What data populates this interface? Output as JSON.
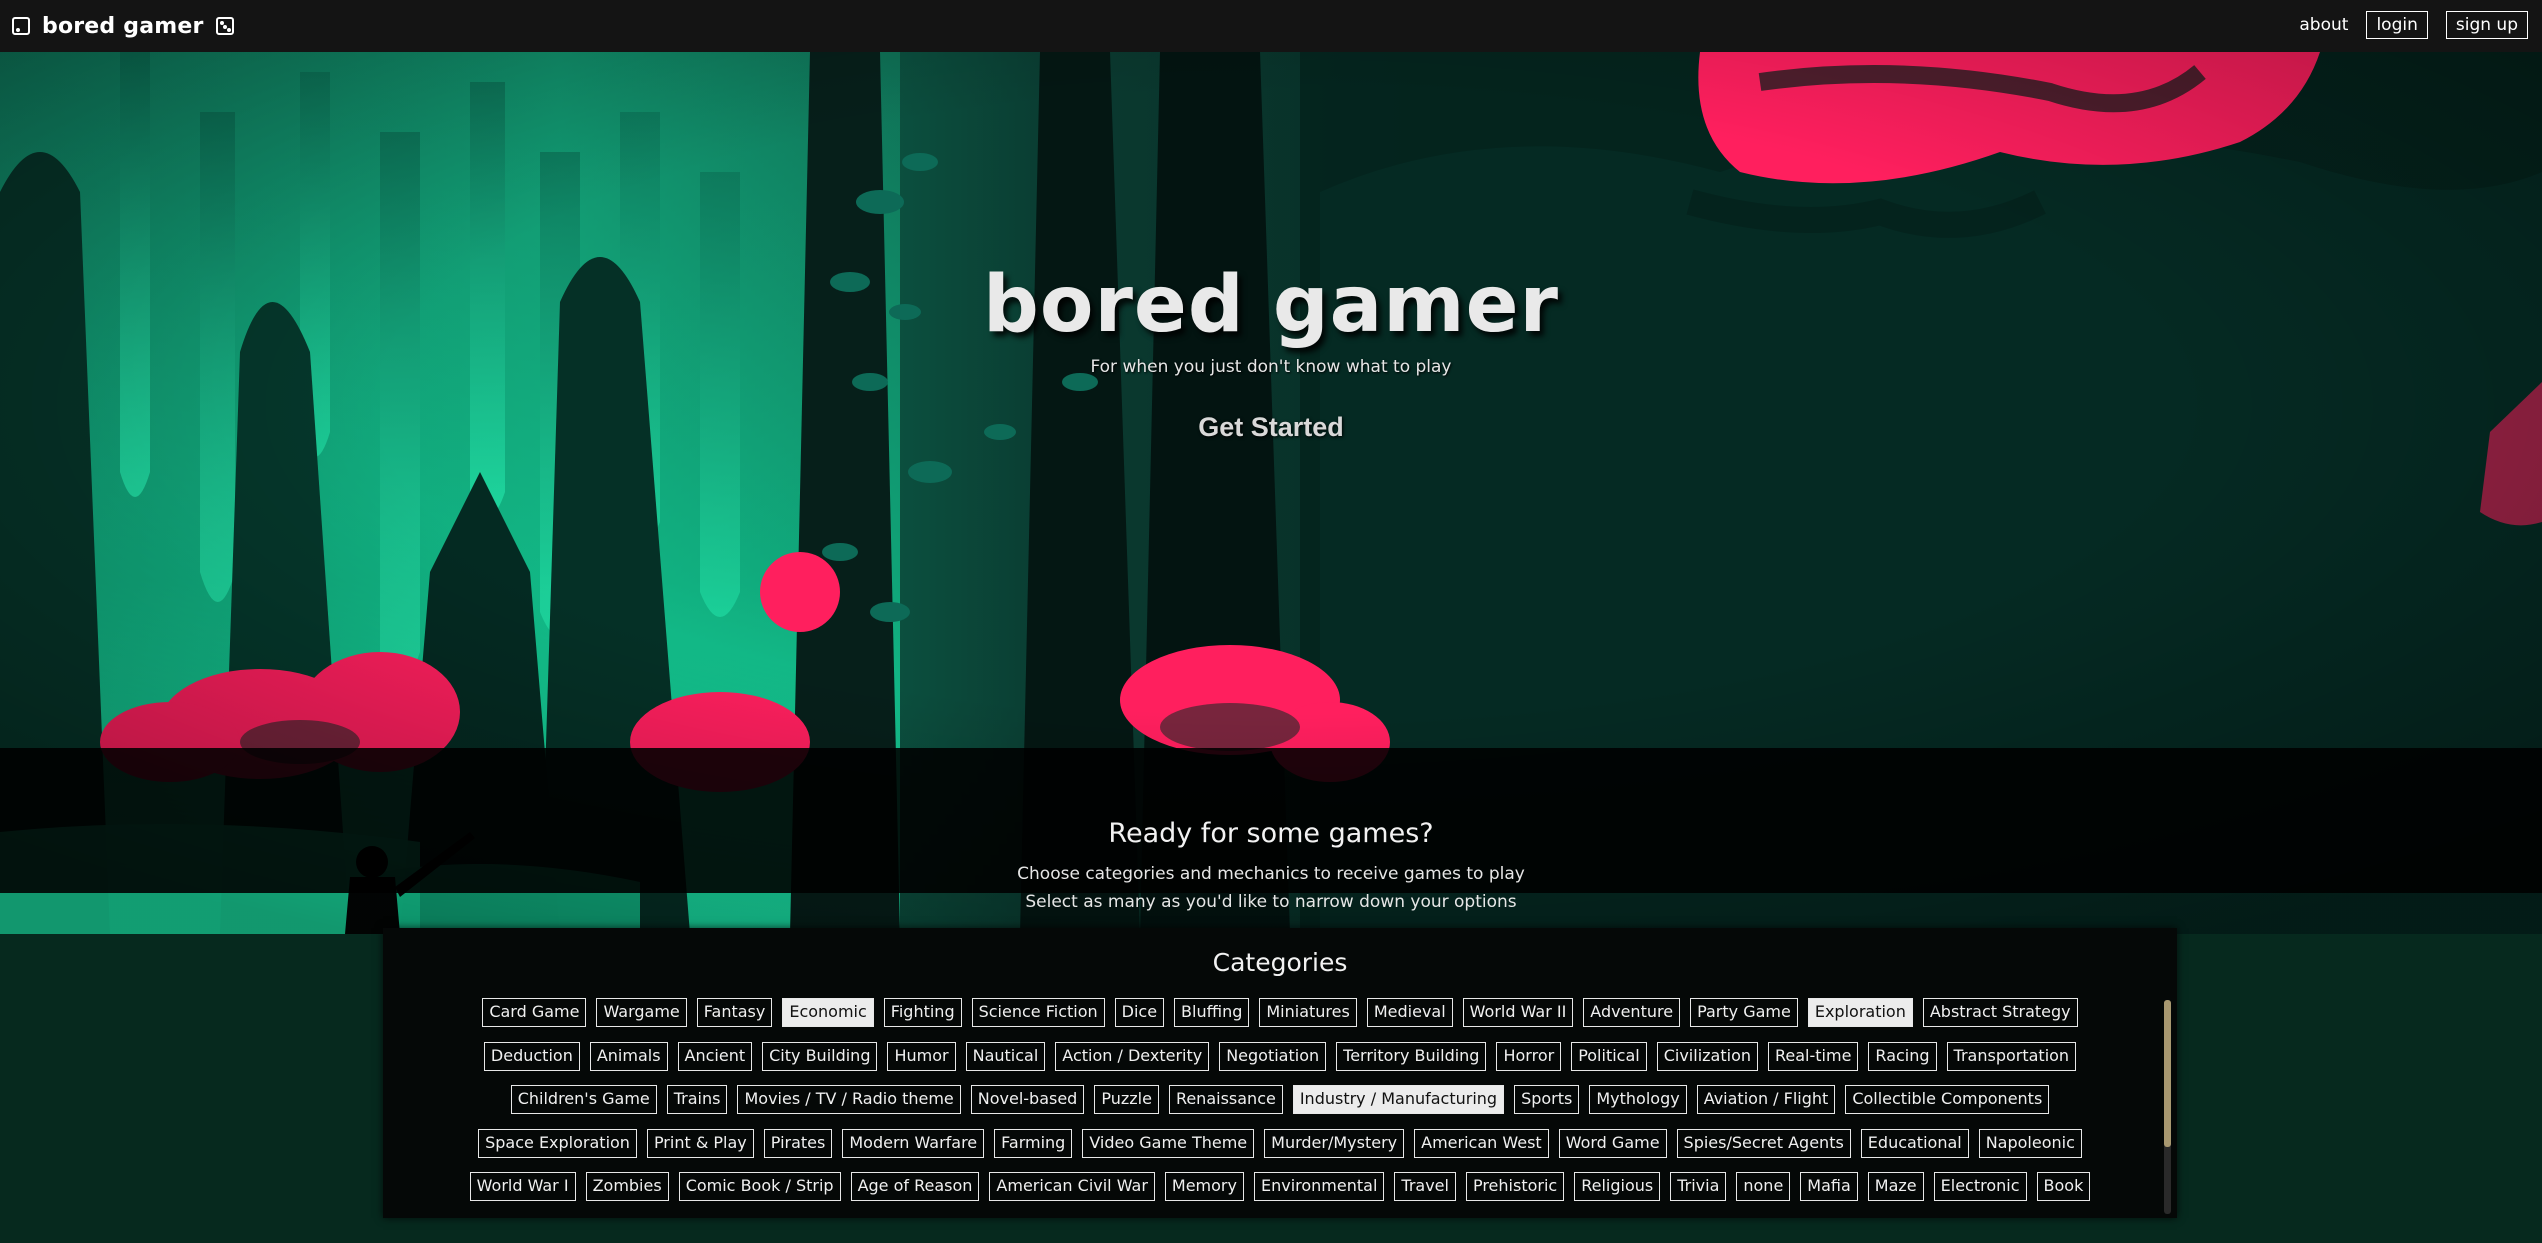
{
  "nav": {
    "brand": "bored gamer",
    "about": "about",
    "login": "login",
    "signup": "sign up"
  },
  "hero": {
    "title": "bored gamer",
    "subtitle": "For when you just don't know what to play",
    "cta": "Get Started"
  },
  "intro": {
    "title": "Ready for some games?",
    "line1": "Choose categories and mechanics to receive games to play",
    "line2": "Select as many as you'd like to narrow down your options"
  },
  "categories": {
    "title": "Categories",
    "rows": [
      [
        {
          "label": "Card Game",
          "selected": false
        },
        {
          "label": "Wargame",
          "selected": false
        },
        {
          "label": "Fantasy",
          "selected": false
        },
        {
          "label": "Economic",
          "selected": true
        },
        {
          "label": "Fighting",
          "selected": false
        },
        {
          "label": "Science Fiction",
          "selected": false
        },
        {
          "label": "Dice",
          "selected": false
        },
        {
          "label": "Bluffing",
          "selected": false
        },
        {
          "label": "Miniatures",
          "selected": false
        },
        {
          "label": "Medieval",
          "selected": false
        },
        {
          "label": "World War II",
          "selected": false
        },
        {
          "label": "Adventure",
          "selected": false
        },
        {
          "label": "Party Game",
          "selected": false
        },
        {
          "label": "Exploration",
          "selected": true
        },
        {
          "label": "Abstract Strategy",
          "selected": false
        }
      ],
      [
        {
          "label": "Deduction",
          "selected": false
        },
        {
          "label": "Animals",
          "selected": false
        },
        {
          "label": "Ancient",
          "selected": false
        },
        {
          "label": "City Building",
          "selected": false
        },
        {
          "label": "Humor",
          "selected": false
        },
        {
          "label": "Nautical",
          "selected": false
        },
        {
          "label": "Action / Dexterity",
          "selected": false
        },
        {
          "label": "Negotiation",
          "selected": false
        },
        {
          "label": "Territory Building",
          "selected": false
        },
        {
          "label": "Horror",
          "selected": false
        },
        {
          "label": "Political",
          "selected": false
        },
        {
          "label": "Civilization",
          "selected": false
        },
        {
          "label": "Real-time",
          "selected": false
        },
        {
          "label": "Racing",
          "selected": false
        },
        {
          "label": "Transportation",
          "selected": false
        }
      ],
      [
        {
          "label": "Children's Game",
          "selected": false
        },
        {
          "label": "Trains",
          "selected": false
        },
        {
          "label": "Movies / TV / Radio theme",
          "selected": false
        },
        {
          "label": "Novel-based",
          "selected": false
        },
        {
          "label": "Puzzle",
          "selected": false
        },
        {
          "label": "Renaissance",
          "selected": false
        },
        {
          "label": "Industry / Manufacturing",
          "selected": true
        },
        {
          "label": "Sports",
          "selected": false
        },
        {
          "label": "Mythology",
          "selected": false
        },
        {
          "label": "Aviation / Flight",
          "selected": false
        },
        {
          "label": "Collectible Components",
          "selected": false
        }
      ],
      [
        {
          "label": "Space Exploration",
          "selected": false
        },
        {
          "label": "Print & Play",
          "selected": false
        },
        {
          "label": "Pirates",
          "selected": false
        },
        {
          "label": "Modern Warfare",
          "selected": false
        },
        {
          "label": "Farming",
          "selected": false
        },
        {
          "label": "Video Game Theme",
          "selected": false
        },
        {
          "label": "Murder/Mystery",
          "selected": false
        },
        {
          "label": "American West",
          "selected": false
        },
        {
          "label": "Word Game",
          "selected": false
        },
        {
          "label": "Spies/Secret Agents",
          "selected": false
        },
        {
          "label": "Educational",
          "selected": false
        },
        {
          "label": "Napoleonic",
          "selected": false
        }
      ],
      [
        {
          "label": "World War I",
          "selected": false
        },
        {
          "label": "Zombies",
          "selected": false
        },
        {
          "label": "Comic Book / Strip",
          "selected": false
        },
        {
          "label": "Age of Reason",
          "selected": false
        },
        {
          "label": "American Civil War",
          "selected": false
        },
        {
          "label": "Memory",
          "selected": false
        },
        {
          "label": "Environmental",
          "selected": false
        },
        {
          "label": "Travel",
          "selected": false
        },
        {
          "label": "Prehistoric",
          "selected": false
        },
        {
          "label": "Religious",
          "selected": false
        },
        {
          "label": "Trivia",
          "selected": false
        },
        {
          "label": "none",
          "selected": false
        },
        {
          "label": "Mafia",
          "selected": false
        },
        {
          "label": "Maze",
          "selected": false
        },
        {
          "label": "Electronic",
          "selected": false
        },
        {
          "label": "Book",
          "selected": false
        }
      ]
    ]
  },
  "colors": {
    "jungle_teal": "#14e8a6",
    "jungle_dark": "#062a22",
    "accent_pink": "#ff1f5e",
    "navbar_bg": "#141414",
    "page_bg": "#06291e",
    "selected_tag_bg": "#ececec",
    "scrollbar_thumb": "#a89870"
  },
  "icons": {
    "brand_left": "dice-icon",
    "brand_right": "dice-icon"
  }
}
